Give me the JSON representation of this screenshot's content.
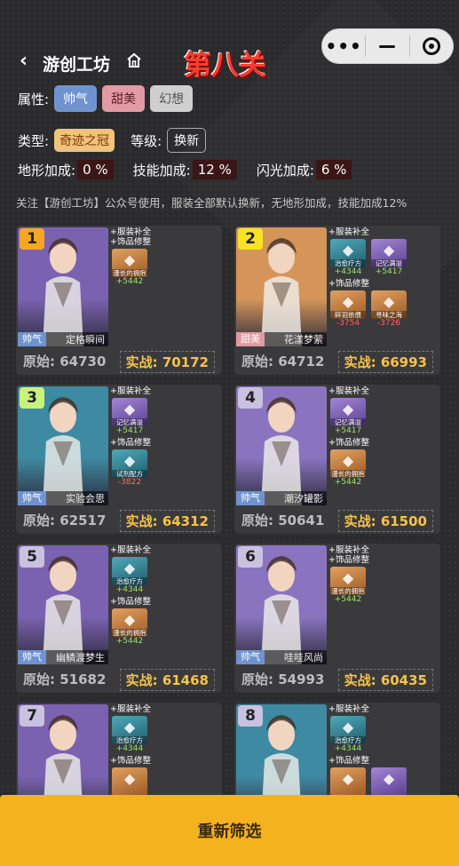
{
  "header": {
    "back_glyph": "‹",
    "brand": "游创工坊",
    "level_title": "第八关"
  },
  "filters": {
    "attr_label": "属性:",
    "attrs": [
      "帅气",
      "甜美",
      "幻想"
    ],
    "type_label": "类型:",
    "type_value": "奇迹之冠",
    "grade_label": "等级:",
    "grade_value": "换新",
    "terrain_label": "地形加成:",
    "terrain_value": "0 %",
    "skill_label": "技能加成:",
    "skill_value": "12 %",
    "flash_label": "闪光加成:",
    "flash_value": "6 %"
  },
  "notice": "关注【游创工坊】公众号使用，服装全部默认换新，无地形加成，技能加成12%",
  "labels": {
    "orig": "原始:",
    "real": "实战:"
  },
  "cards": [
    {
      "rank": "1",
      "rank_color": "#f5a623",
      "tag": "帅气",
      "tag_type": "blue",
      "name": "定格瞬间",
      "orig": "64730",
      "real": "70172",
      "bg": "#7b62b0",
      "lines": [
        {
          "label": "+服装补全",
          "items": []
        },
        {
          "label": "+饰品修整",
          "items": [
            {
              "name": "漫长的拥抱",
              "val": "+5442",
              "color": "orange",
              "sign": "pos"
            }
          ]
        }
      ]
    },
    {
      "rank": "2",
      "rank_color": "#f7e324",
      "tag": "甜美",
      "tag_type": "pink",
      "name": "花漾梦萦",
      "orig": "64712",
      "real": "66993",
      "bg": "#d5955a",
      "lines": [
        {
          "label": "+服装补全",
          "items": [
            {
              "name": "治愈疗方",
              "val": "+4344",
              "color": "teal",
              "sign": "pos"
            },
            {
              "name": "记忆满溢",
              "val": "+5417",
              "color": "purple",
              "sign": "pos"
            }
          ]
        },
        {
          "label": "+饰品修整",
          "items": [
            {
              "name": "碎羽依偎",
              "val": "-3754",
              "color": "orange",
              "sign": "neg"
            },
            {
              "name": "寻味之海",
              "val": "-3726",
              "color": "orange",
              "sign": "neg"
            }
          ]
        }
      ]
    },
    {
      "rank": "3",
      "rank_color": "#c9f27a",
      "tag": "帅气",
      "tag_type": "blue",
      "name": "实验会思",
      "orig": "62517",
      "real": "64312",
      "bg": "#3f8aa3",
      "lines": [
        {
          "label": "+服装补全",
          "items": [
            {
              "name": "记忆满溢",
              "val": "+5417",
              "color": "purple",
              "sign": "pos"
            }
          ]
        },
        {
          "label": "+饰品修整",
          "items": [
            {
              "name": "试剂配方",
              "val": "-3822",
              "color": "teal",
              "sign": "neg"
            }
          ]
        }
      ]
    },
    {
      "rank": "4",
      "rank_color": "#c8c2e0",
      "tag": "帅气",
      "tag_type": "blue",
      "name": "潮汐罐影",
      "orig": "50641",
      "real": "61500",
      "bg": "#8a74c0",
      "lines": [
        {
          "label": "+服装补全",
          "items": [
            {
              "name": "记忆满溢",
              "val": "+5417",
              "color": "purple",
              "sign": "pos"
            }
          ]
        },
        {
          "label": "+饰品修整",
          "items": [
            {
              "name": "漫长的拥抱",
              "val": "+5442",
              "color": "orange",
              "sign": "pos"
            }
          ]
        }
      ]
    },
    {
      "rank": "5",
      "rank_color": "#c8c2e0",
      "tag": "帅气",
      "tag_type": "blue",
      "name": "幽鳞渡梦生",
      "orig": "51682",
      "real": "61468",
      "bg": "#7b62b0",
      "lines": [
        {
          "label": "+服装补全",
          "items": [
            {
              "name": "治愈疗方",
              "val": "+4344",
              "color": "teal",
              "sign": "pos"
            }
          ]
        },
        {
          "label": "+饰品修整",
          "items": [
            {
              "name": "漫长的拥抱",
              "val": "+5442",
              "color": "orange",
              "sign": "pos"
            }
          ]
        }
      ]
    },
    {
      "rank": "6",
      "rank_color": "#c8c2e0",
      "tag": "帅气",
      "tag_type": "blue",
      "name": "哇哇风尚",
      "orig": "54993",
      "real": "60435",
      "bg": "#8a74c0",
      "lines": [
        {
          "label": "+服装补全",
          "items": []
        },
        {
          "label": "+饰品修整",
          "items": [
            {
              "name": "漫长的拥抱",
              "val": "+5442",
              "color": "orange",
              "sign": "pos"
            }
          ]
        }
      ]
    },
    {
      "rank": "7",
      "rank_color": "#c8c2e0",
      "tag": "",
      "tag_type": "blue",
      "name": "",
      "orig": "",
      "real": "",
      "bg": "#7b62b0",
      "lines": [
        {
          "label": "+服装补全",
          "items": [
            {
              "name": "治愈疗方",
              "val": "+4344",
              "color": "teal",
              "sign": "pos"
            }
          ]
        },
        {
          "label": "+饰品修整",
          "items": [
            {
              "name": "",
              "val": "",
              "color": "orange",
              "sign": "pos"
            }
          ]
        }
      ]
    },
    {
      "rank": "8",
      "rank_color": "#c8c2e0",
      "tag": "",
      "tag_type": "blue",
      "name": "",
      "orig": "",
      "real": "",
      "bg": "#3f8aa3",
      "lines": [
        {
          "label": "+服装补全",
          "items": [
            {
              "name": "治愈疗方",
              "val": "+4344",
              "color": "teal",
              "sign": "pos"
            }
          ]
        },
        {
          "label": "+饰品修整",
          "items": [
            {
              "name": "",
              "val": "",
              "color": "orange",
              "sign": "pos"
            },
            {
              "name": "",
              "val": "",
              "color": "purple",
              "sign": "pos"
            }
          ]
        }
      ]
    }
  ],
  "bottom_button": "重新筛选",
  "icons": {
    "back": "chevron-left-icon",
    "home": "home-icon",
    "more": "more-dots-icon",
    "minimize": "minus-icon",
    "close": "target-icon"
  }
}
